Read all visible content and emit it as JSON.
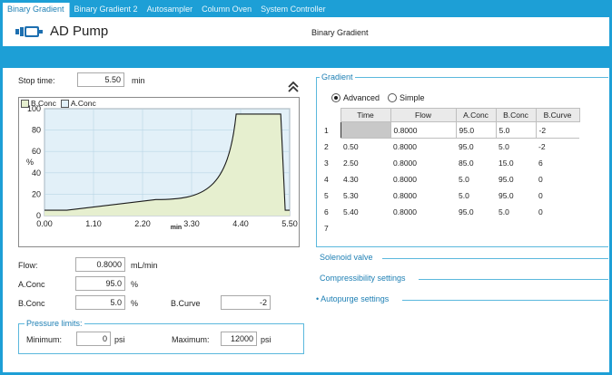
{
  "tabs": [
    {
      "label": "Binary Gradient",
      "active": true
    },
    {
      "label": "Binary Gradient 2",
      "active": false
    },
    {
      "label": "Autosampler",
      "active": false
    },
    {
      "label": "Column Oven",
      "active": false
    },
    {
      "label": "System Controller",
      "active": false
    }
  ],
  "header": {
    "title": "AD Pump",
    "subtitle": "Binary Gradient",
    "icon": "pump-icon"
  },
  "stop_time": {
    "label": "Stop time:",
    "value": "5.50",
    "unit": "min"
  },
  "chart_legend": {
    "b": "B.Conc",
    "a": "A.Conc"
  },
  "chart_data": {
    "type": "area",
    "x": [
      0.0,
      0.5,
      2.5,
      4.3,
      5.3,
      5.4,
      5.5
    ],
    "series": [
      {
        "name": "B.Conc",
        "values": [
          5.0,
          5.0,
          15.0,
          95.0,
          95.0,
          5.0,
          5.0
        ]
      }
    ],
    "xlabel": "min",
    "ylabel": "%",
    "xlim": [
      0.0,
      5.5
    ],
    "ylim": [
      0,
      100
    ],
    "xticks": [
      "0.00",
      "1.10",
      "2.20",
      "3.30",
      "4.40",
      "5.50"
    ],
    "yticks": [
      "0",
      "20",
      "40",
      "60",
      "80",
      "100"
    ],
    "grid": true,
    "colors": {
      "fill": "#e6efcf",
      "line": "#1a1a1a",
      "plot_bg": "#e2f0f8",
      "grid": "#b9d6e6"
    }
  },
  "flow": {
    "label": "Flow:",
    "value": "0.8000",
    "unit": "mL/min"
  },
  "a_conc": {
    "label": "A.Conc",
    "value": "95.0",
    "unit": "%"
  },
  "b_conc": {
    "label": "B.Conc",
    "value": "5.0",
    "unit": "%"
  },
  "b_curve": {
    "label": "B.Curve",
    "value": "-2"
  },
  "pressure": {
    "title": "Pressure limits:",
    "min_label": "Minimum:",
    "min_value": "0",
    "min_unit": "psi",
    "max_label": "Maximum:",
    "max_value": "12000",
    "max_unit": "psi"
  },
  "gradient": {
    "title": "Gradient",
    "mode_advanced": "Advanced",
    "mode_simple": "Simple",
    "selected_mode": "Advanced",
    "columns": [
      "Time",
      "Flow",
      "A.Conc",
      "B.Conc",
      "B.Curve"
    ],
    "rows": [
      {
        "n": "1",
        "time": "",
        "flow": "0.8000",
        "a": "95.0",
        "b": "5.0",
        "curve": "-2"
      },
      {
        "n": "2",
        "time": "0.50",
        "flow": "0.8000",
        "a": "95.0",
        "b": "5.0",
        "curve": "-2"
      },
      {
        "n": "3",
        "time": "2.50",
        "flow": "0.8000",
        "a": "85.0",
        "b": "15.0",
        "curve": "6"
      },
      {
        "n": "4",
        "time": "4.30",
        "flow": "0.8000",
        "a": "5.0",
        "b": "95.0",
        "curve": "0"
      },
      {
        "n": "5",
        "time": "5.30",
        "flow": "0.8000",
        "a": "5.0",
        "b": "95.0",
        "curve": "0"
      },
      {
        "n": "6",
        "time": "5.40",
        "flow": "0.8000",
        "a": "95.0",
        "b": "5.0",
        "curve": "0"
      },
      {
        "n": "7",
        "time": "",
        "flow": "",
        "a": "",
        "b": "",
        "curve": ""
      }
    ]
  },
  "sections": {
    "solenoid": "Solenoid valve",
    "compressibility": "Compressibility settings",
    "autopurge": "Autopurge settings"
  },
  "colors": {
    "accent": "#1d9fd6",
    "section_text": "#1d7fb4"
  }
}
